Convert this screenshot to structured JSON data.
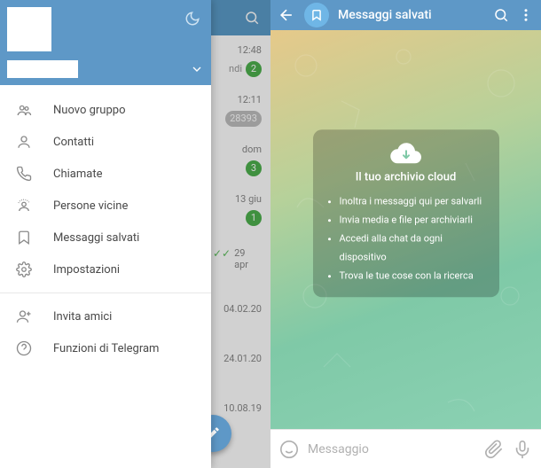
{
  "left": {
    "drawer": {
      "items": [
        {
          "label": "Nuovo gruppo",
          "icon": "group"
        },
        {
          "label": "Contatti",
          "icon": "person"
        },
        {
          "label": "Chiamate",
          "icon": "phone"
        },
        {
          "label": "Persone vicine",
          "icon": "nearby"
        },
        {
          "label": "Messaggi salvati",
          "icon": "bookmark"
        },
        {
          "label": "Impostazioni",
          "icon": "gear"
        }
      ],
      "secondary": [
        {
          "label": "Invita amici",
          "icon": "adduser"
        },
        {
          "label": "Funzioni di Telegram",
          "icon": "help"
        }
      ]
    },
    "chat_rows": [
      {
        "time": "12:48",
        "tail": "ndi",
        "badge": "2",
        "badge_style": "green"
      },
      {
        "time": "12:11",
        "tail": "",
        "badge": "28393",
        "badge_style": "grey"
      },
      {
        "time": "dom",
        "tail": "",
        "badge": "3",
        "badge_style": "green"
      },
      {
        "time": "13 giu",
        "tail": "",
        "badge": "1",
        "badge_style": "green"
      },
      {
        "time": "29 apr",
        "tail": "",
        "ticks": "✓✓"
      },
      {
        "time": "04.02.20"
      },
      {
        "time": "24.01.20"
      },
      {
        "time": "10.08.19"
      }
    ]
  },
  "right": {
    "title": "Messaggi salvati",
    "cloud": {
      "heading": "Il tuo archivio cloud",
      "bullets": [
        "Inoltra i messaggi qui per salvarli",
        "Invia media e file per archiviarli",
        "Accedi alla chat da ogni dispositivo",
        "Trova le tue cose con la ricerca"
      ]
    },
    "input_placeholder": "Messaggio"
  }
}
